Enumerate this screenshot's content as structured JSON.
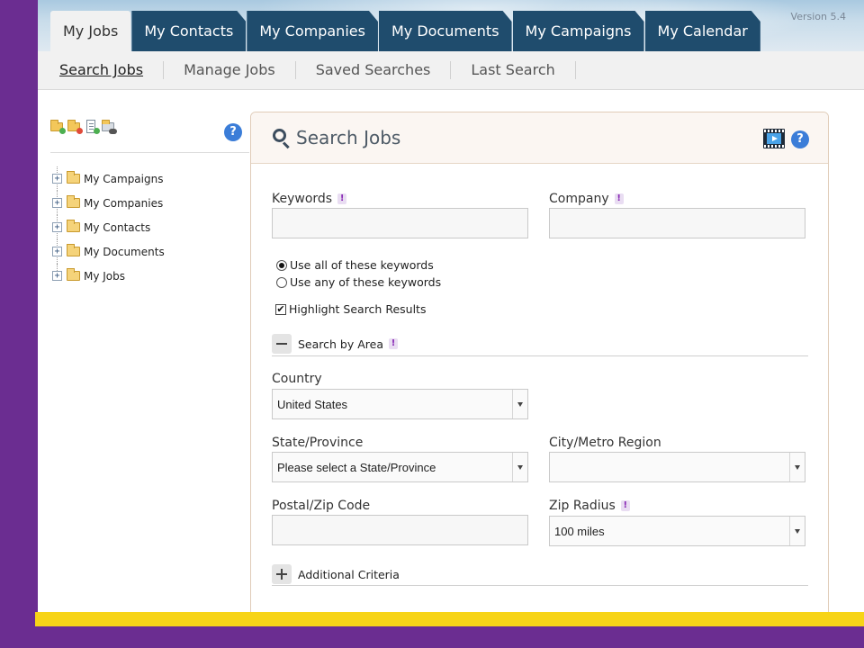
{
  "version": "Version 5.4",
  "top_tabs": [
    "My Jobs",
    "My Contacts",
    "My Companies",
    "My Documents",
    "My Campaigns",
    "My Calendar"
  ],
  "subnav": [
    "Search Jobs",
    "Manage Jobs",
    "Saved Searches",
    "Last Search"
  ],
  "sidebar": {
    "help": "?",
    "tree": [
      {
        "label": "My Campaigns",
        "expander": "+"
      },
      {
        "label": "My Companies",
        "expander": "+"
      },
      {
        "label": "My Contacts",
        "expander": "+"
      },
      {
        "label": "My Documents",
        "expander": "+"
      },
      {
        "label": "My Jobs",
        "expander": "+"
      }
    ]
  },
  "main": {
    "title": "Search Jobs",
    "help": "?",
    "keywords_label": "Keywords",
    "keywords_value": "",
    "company_label": "Company",
    "company_value": "",
    "info_mark": "!",
    "radio_all": "Use all of these keywords",
    "radio_any": "Use any of these keywords",
    "highlight_label": "Highlight Search Results",
    "highlight_check": "✔",
    "search_by_area": "Search by Area",
    "country_label": "Country",
    "country_value": "United States",
    "state_label": "State/Province",
    "state_value": "Please select a State/Province",
    "city_label": "City/Metro Region",
    "city_value": "",
    "zip_label": "Postal/Zip Code",
    "zip_value": "",
    "radius_label": "Zip Radius",
    "radius_value": "100 miles",
    "additional_criteria": "Additional Criteria"
  },
  "colors": {
    "frame": "#6b2d91",
    "tab_dark": "#1f4c6d",
    "bottom_bar": "#f7d417",
    "help_blue": "#3b7dd8"
  }
}
